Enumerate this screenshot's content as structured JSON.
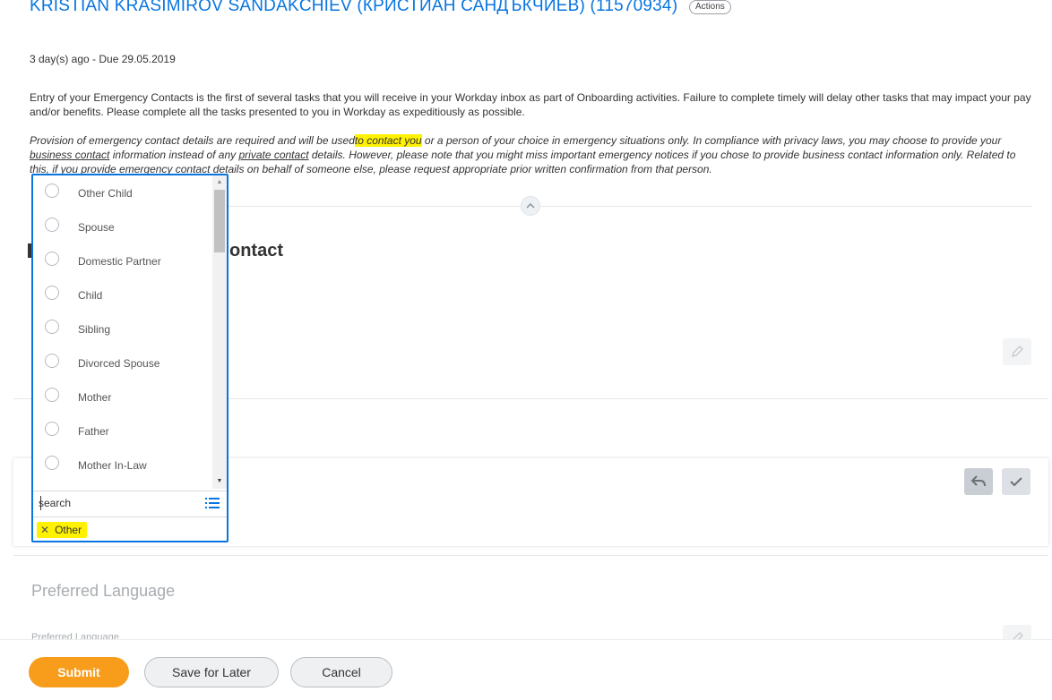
{
  "header": {
    "title": "KRISTIAN KRASIMIROV SANDAKCHIEV (КРИСТИАН САНДЪКЧИЕВ) (11570934)",
    "actions_label": "Actions",
    "due": "3 day(s) ago - Due 29.05.2019"
  },
  "intro": {
    "text": "Entry of your Emergency Contacts is the first of several tasks that you will receive in your Workday inbox as part of Onboarding activities. Failure to complete timely will delay other tasks that may impact your pay and/or benefits. Please complete all the tasks presented to you in Workday as expeditiously as possible."
  },
  "privacy": {
    "part1": "Provision of emergency contact details are required and will be used",
    "highlight": "to contact you",
    "part2": " or a person of your choice in emergency situations only.  In compliance with privacy laws, you may choose to provide your ",
    "link1": "business contact",
    "part3": " information instead of any ",
    "link2": "private contact",
    "part4": " details. However, please note that you might miss important emergency notices if you chose to provide business contact information only. Related to this, if you provide emergency contact details on behalf of someone else, please request appropriate prior written confirmation from that person."
  },
  "section": {
    "title_visible": "ontact"
  },
  "dropdown": {
    "options": [
      "Other Child",
      "Spouse",
      "Domestic Partner",
      "Child",
      "Sibling",
      "Divorced Spouse",
      "Mother",
      "Father",
      "Mother In-Law"
    ],
    "search_placeholder": "search",
    "selected": "Other"
  },
  "preferred_language": {
    "title": "Preferred Language",
    "label": "Preferred Language"
  },
  "footer": {
    "submit": "Submit",
    "save_later": "Save for Later",
    "cancel": "Cancel"
  },
  "colors": {
    "accent_blue": "#0875e1",
    "submit_orange": "#f89c1c",
    "highlight_yellow": "#fff200"
  }
}
